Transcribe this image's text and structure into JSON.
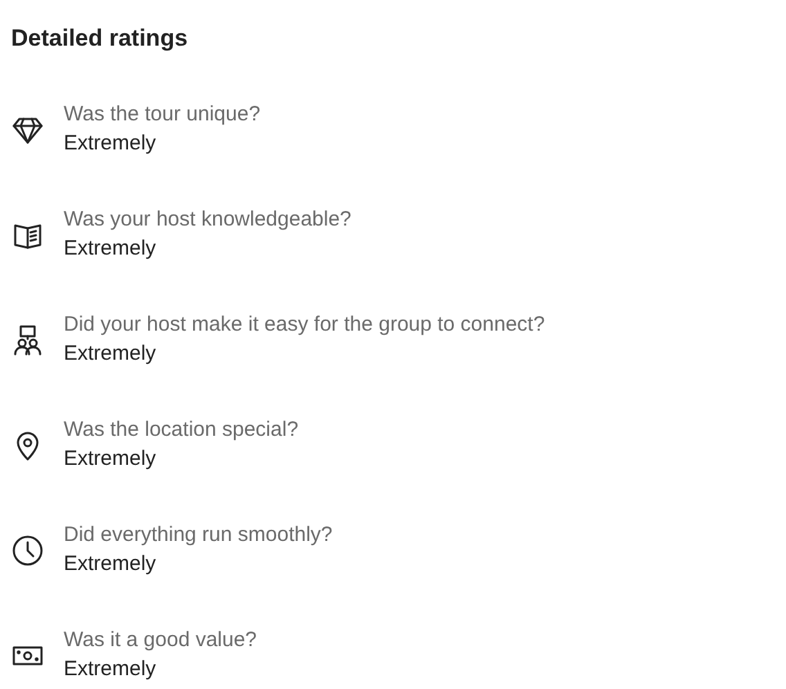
{
  "title": "Detailed ratings",
  "ratings": [
    {
      "kind": "diamond",
      "question": "Was the tour unique?",
      "answer": "Extremely"
    },
    {
      "kind": "book",
      "question": "Was your host knowledgeable?",
      "answer": "Extremely"
    },
    {
      "kind": "group",
      "question": "Did your host make it easy for the group to connect?",
      "answer": "Extremely"
    },
    {
      "kind": "pin",
      "question": "Was the location special?",
      "answer": "Extremely"
    },
    {
      "kind": "clock",
      "question": "Did everything run smoothly?",
      "answer": "Extremely"
    },
    {
      "kind": "cash",
      "question": "Was it a good value?",
      "answer": "Extremely"
    }
  ]
}
